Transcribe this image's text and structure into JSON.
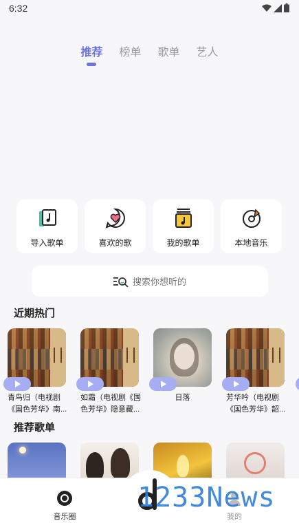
{
  "status_bar": {
    "time": "6:32",
    "icons": [
      "wifi-icon",
      "signal-icon",
      "battery-icon"
    ]
  },
  "tabs": [
    {
      "label": "推荐",
      "active": true
    },
    {
      "label": "榜单",
      "active": false
    },
    {
      "label": "歌单",
      "active": false
    },
    {
      "label": "艺人",
      "active": false
    }
  ],
  "quick_actions": [
    {
      "label": "导入歌单",
      "icon": "import-playlist-icon"
    },
    {
      "label": "喜欢的歌",
      "icon": "heart-chat-icon"
    },
    {
      "label": "我的歌单",
      "icon": "my-playlist-icon"
    },
    {
      "label": "本地音乐",
      "icon": "local-music-disc-icon"
    }
  ],
  "search": {
    "placeholder": "搜索你想听的",
    "icon": "search-list-icon"
  },
  "sections": {
    "hot": "近期热门",
    "playlists": "推荐歌单"
  },
  "hot_items": [
    {
      "title": "青鸟归（电视剧《国色芳华》南..."
    },
    {
      "title": "如霜（电视剧《国色芳华》隐意藏..."
    },
    {
      "title": "日落"
    },
    {
      "title": "芳华吟（电视剧《国色芳华》韶..."
    }
  ],
  "bottom_nav": [
    {
      "label": "音乐圈",
      "icon": "music-circle-icon"
    },
    {
      "label": "",
      "icon": "center-logo-icon"
    },
    {
      "label": "我的",
      "icon": "profile-icon"
    }
  ],
  "watermark": "1233News",
  "colors": {
    "accent": "#6c74d8",
    "play_pill": "#a7adf2",
    "background": "#f7f7f9"
  }
}
